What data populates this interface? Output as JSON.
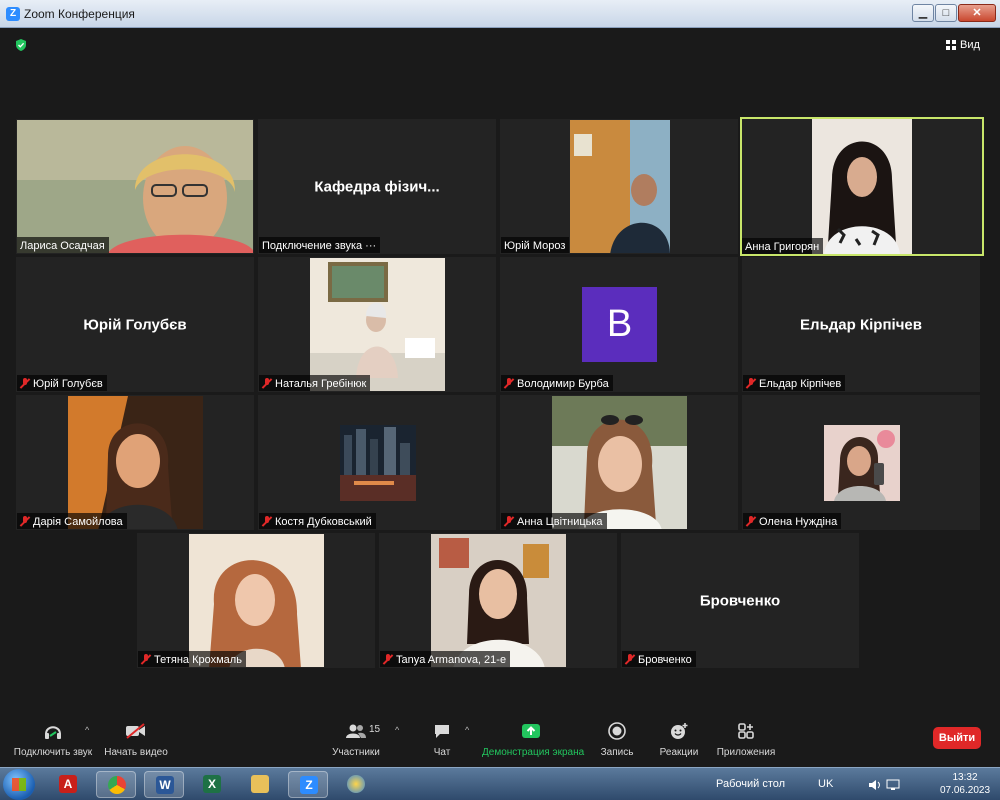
{
  "window": {
    "title": "Zoom Конференция",
    "minimize": "▁",
    "maximize": "□",
    "close": "✕"
  },
  "header": {
    "view_label": "Вид"
  },
  "tiles": [
    {
      "name": "Лариса Осадчая",
      "display": "",
      "muted": false,
      "active": false
    },
    {
      "name": "Подключение звука ···",
      "display": "Кафедра фізич...",
      "muted": false,
      "active": false
    },
    {
      "name": "Юрій Мороз",
      "display": "",
      "muted": false,
      "active": false
    },
    {
      "name": "Анна Григорян",
      "display": "",
      "muted": false,
      "active": true
    },
    {
      "name": "Юрій Голубєв",
      "display": "Юрій Голубєв",
      "muted": true,
      "active": false
    },
    {
      "name": "Наталья Гребінюк",
      "display": "",
      "muted": true,
      "active": false
    },
    {
      "name": "Володимир Бурба",
      "display": "",
      "avatar_letter": "B",
      "muted": true,
      "active": false
    },
    {
      "name": "Ельдар Кірпічев",
      "display": "Ельдар Кірпічев",
      "muted": true,
      "active": false
    },
    {
      "name": "Дарія Самойлова",
      "display": "",
      "muted": true,
      "active": false
    },
    {
      "name": "Костя Дубковський",
      "display": "",
      "muted": true,
      "active": false
    },
    {
      "name": "Анна Цвітницька",
      "display": "",
      "muted": true,
      "active": false
    },
    {
      "name": "Олена Нуждіна",
      "display": "",
      "muted": true,
      "active": false
    },
    {
      "name": "Тетяна Крохмаль",
      "display": "",
      "muted": true,
      "active": false
    },
    {
      "name": "Tanya Armanova, 21-е",
      "display": "",
      "muted": true,
      "active": false
    },
    {
      "name": "Бровченко",
      "display": "Бровченко",
      "muted": true,
      "active": false
    }
  ],
  "toolbar": {
    "audio_label": "Подключить звук",
    "video_label": "Начать видео",
    "participants_label": "Участники",
    "participants_count": "15",
    "chat_label": "Чат",
    "share_label": "Демонстрация экрана",
    "record_label": "Запись",
    "reactions_label": "Реакции",
    "apps_label": "Приложения",
    "leave_label": "Выйти"
  },
  "taskbar": {
    "desktop_label": "Рабочий стол",
    "language": "UK",
    "time": "13:32",
    "date": "07.06.2023"
  },
  "colors": {
    "active_border": "#c8e66a",
    "leave": "#e02828",
    "share": "#22c55e",
    "avatar": "#5b2dbd"
  }
}
